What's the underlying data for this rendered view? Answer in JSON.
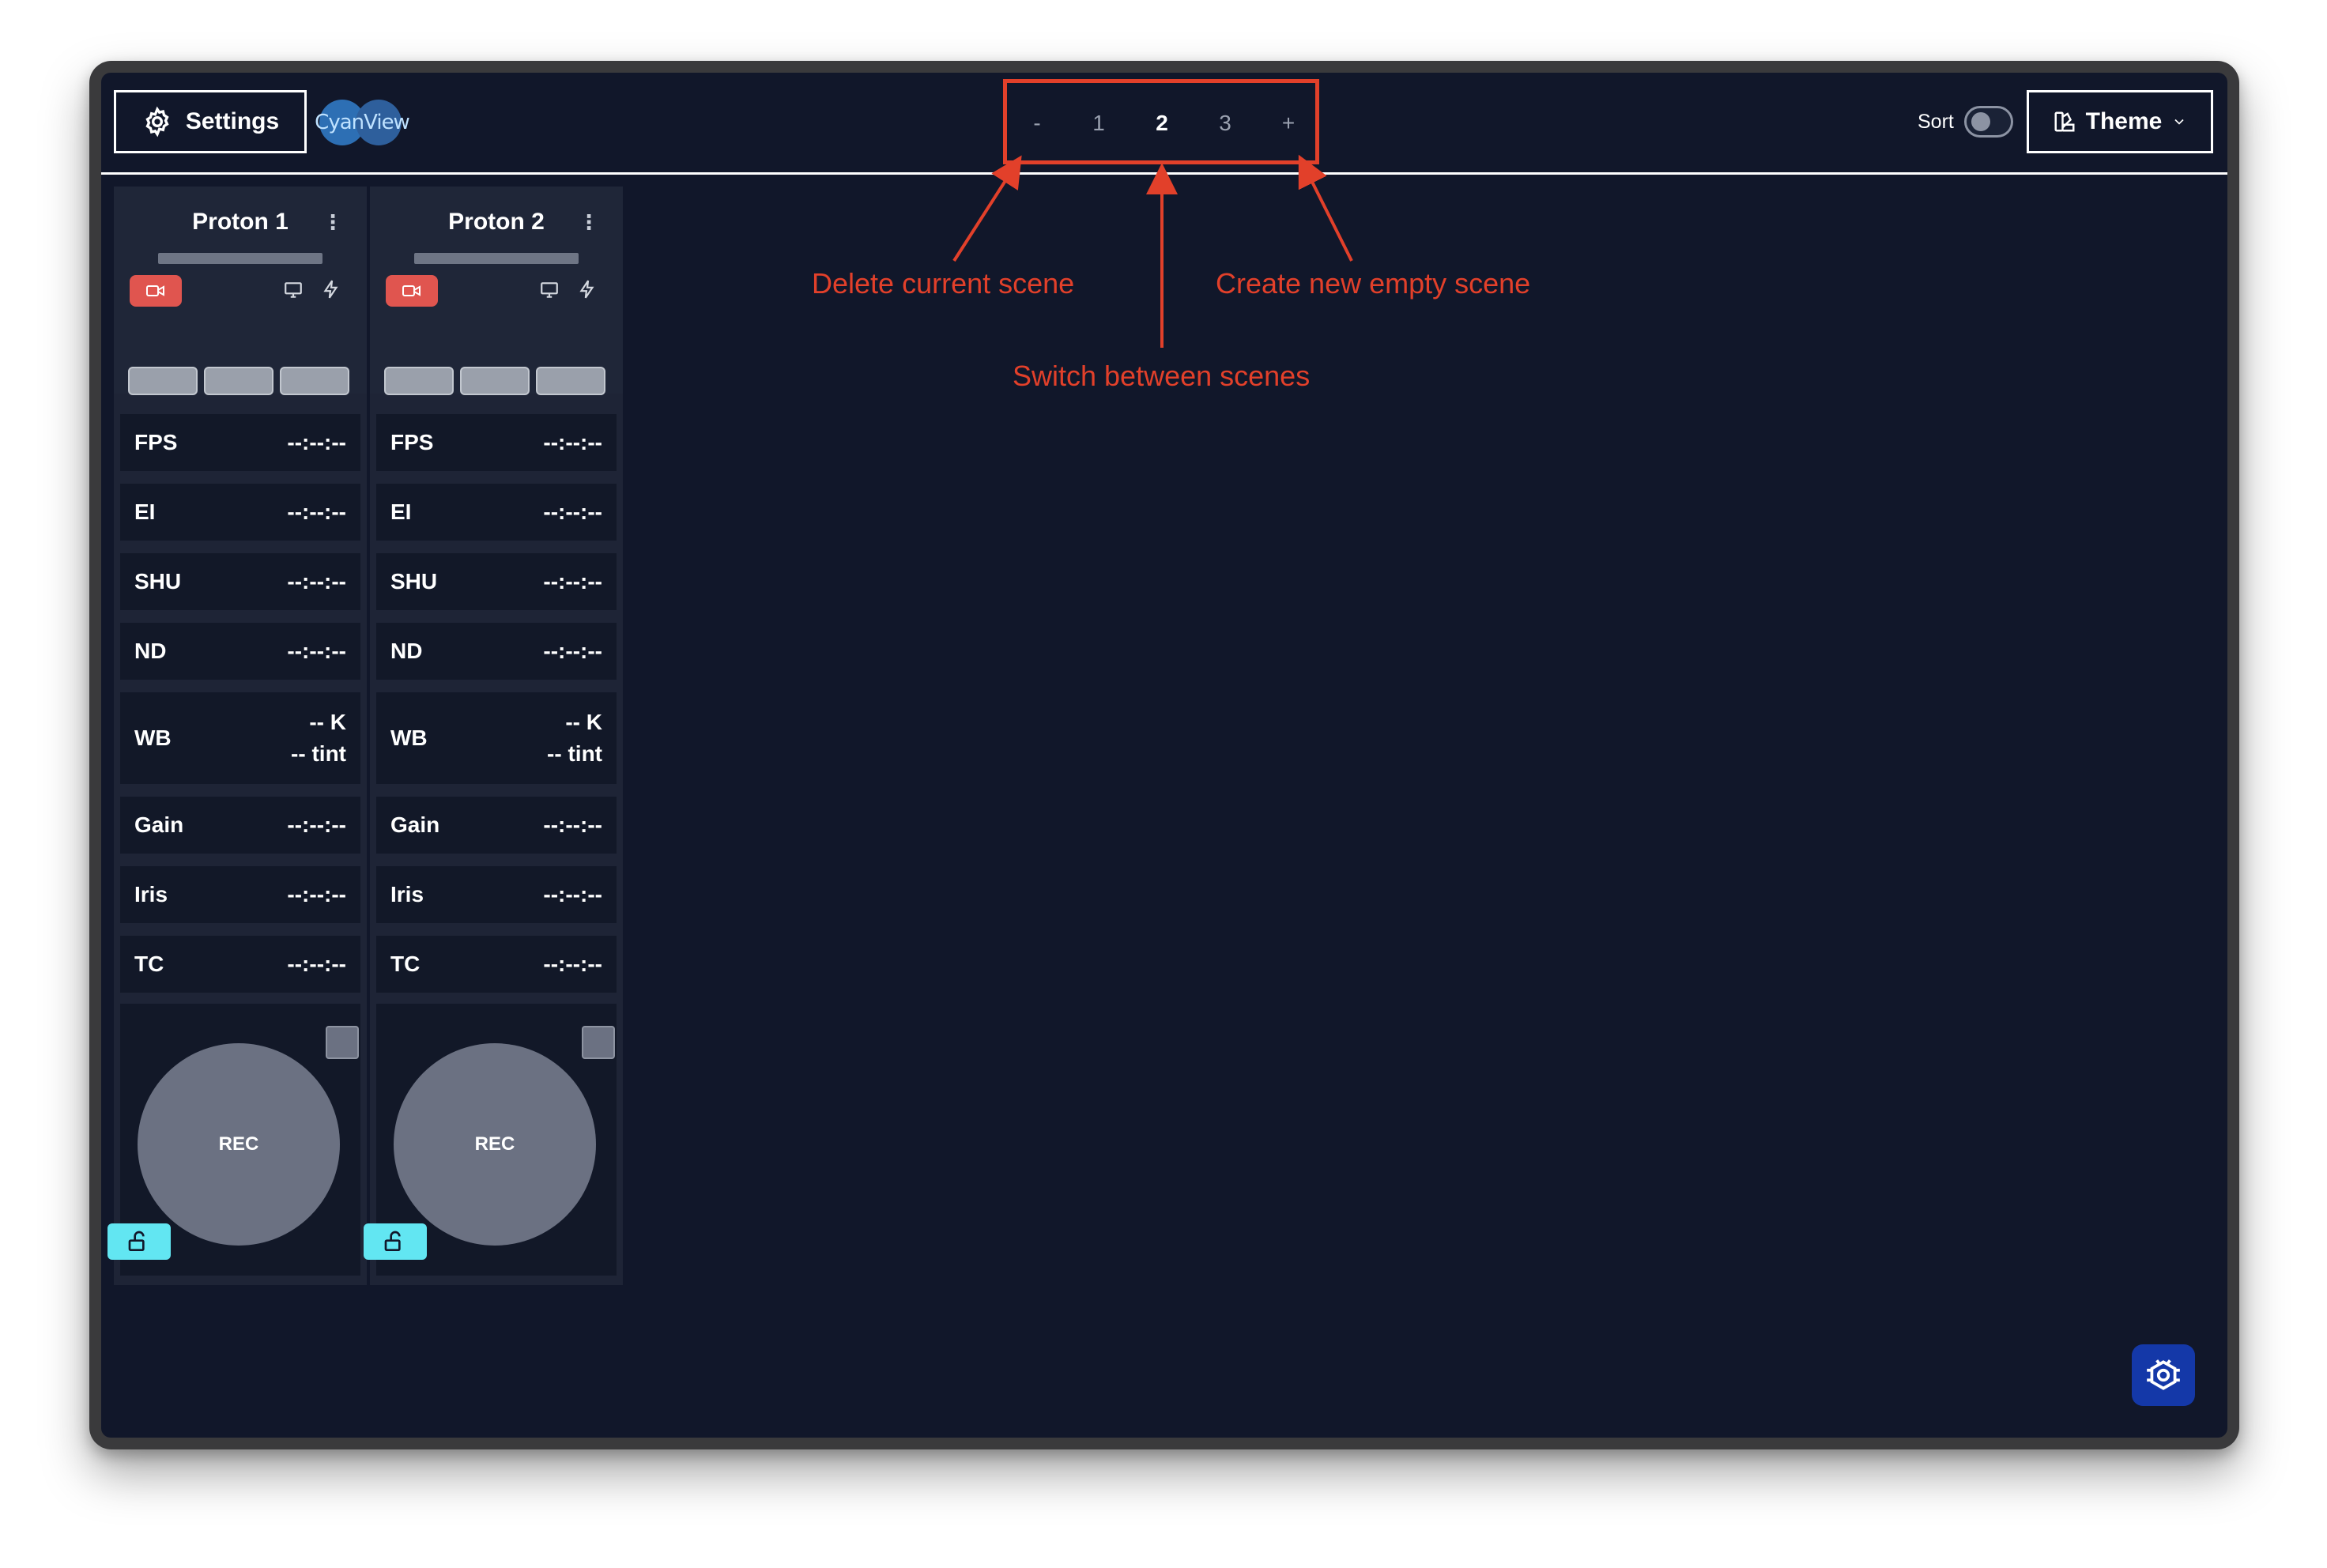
{
  "header": {
    "settings_label": "Settings",
    "logo_text": "CyanView",
    "sort_label": "Sort",
    "sort_enabled": false,
    "theme_label": "Theme"
  },
  "scenes": {
    "delete_label": "-",
    "add_label": "+",
    "items": [
      "1",
      "2",
      "3"
    ],
    "active": "2"
  },
  "annotations": {
    "delete": "Delete current scene",
    "switch": "Switch between scenes",
    "create": "Create new empty scene",
    "color": "#e2402a"
  },
  "cameras": [
    {
      "name": "Proton 1",
      "rows": [
        {
          "label": "FPS",
          "value": "--:--:--"
        },
        {
          "label": "EI",
          "value": "--:--:--"
        },
        {
          "label": "SHU",
          "value": "--:--:--"
        },
        {
          "label": "ND",
          "value": "--:--:--"
        },
        {
          "label": "WB",
          "value": "-- K",
          "value2": "-- tint"
        },
        {
          "label": "Gain",
          "value": "--:--:--"
        },
        {
          "label": "Iris",
          "value": "--:--:--"
        },
        {
          "label": "TC",
          "value": "--:--:--"
        }
      ],
      "rec_label": "REC"
    },
    {
      "name": "Proton 2",
      "rows": [
        {
          "label": "FPS",
          "value": "--:--:--"
        },
        {
          "label": "EI",
          "value": "--:--:--"
        },
        {
          "label": "SHU",
          "value": "--:--:--"
        },
        {
          "label": "ND",
          "value": "--:--:--"
        },
        {
          "label": "WB",
          "value": "-- K",
          "value2": "-- tint"
        },
        {
          "label": "Gain",
          "value": "--:--:--"
        },
        {
          "label": "Iris",
          "value": "--:--:--"
        },
        {
          "label": "TC",
          "value": "--:--:--"
        }
      ],
      "rec_label": "REC"
    }
  ],
  "colors": {
    "background": "#11172a",
    "rec_badge": "#e0554f",
    "lock_button": "#62e6f2",
    "bug_button": "#1438a8"
  },
  "icons": {
    "settings": "gear-icon",
    "theme": "palette-icon",
    "rec_badge": "video-camera-icon",
    "monitor": "monitor-icon",
    "power": "bolt-icon",
    "lock": "unlock-icon",
    "debug": "bug-icon"
  }
}
